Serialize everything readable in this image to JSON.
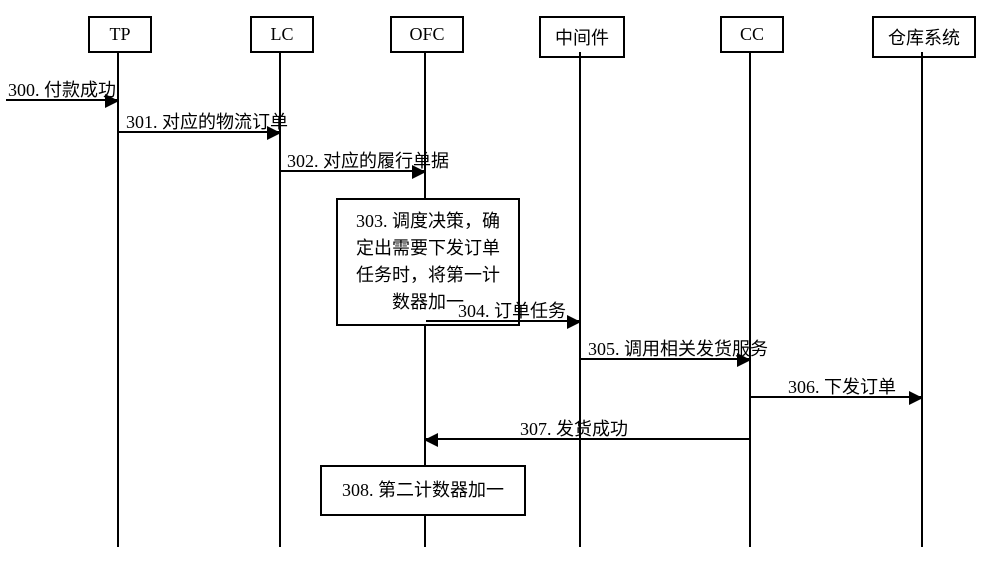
{
  "participants": {
    "tp": {
      "label": "TP"
    },
    "lc": {
      "label": "LC"
    },
    "ofc": {
      "label": "OFC"
    },
    "mid": {
      "label": "中间件"
    },
    "cc": {
      "label": "CC"
    },
    "wh": {
      "label": "仓库系统"
    }
  },
  "messages": {
    "m300": {
      "label": "300. 付款成功"
    },
    "m301": {
      "label": "301. 对应的物流订单"
    },
    "m302": {
      "label": "302. 对应的履行单据"
    },
    "m303": {
      "label": "303. 调度决策，确定出需要下发订单任务时，将第一计数器加一"
    },
    "m304": {
      "label": "304. 订单任务"
    },
    "m305": {
      "label": "305. 调用相关发货服务"
    },
    "m306": {
      "label": "306. 下发订单"
    },
    "m307": {
      "label": "307. 发货成功"
    },
    "m308": {
      "label": "308. 第二计数器加一"
    }
  }
}
